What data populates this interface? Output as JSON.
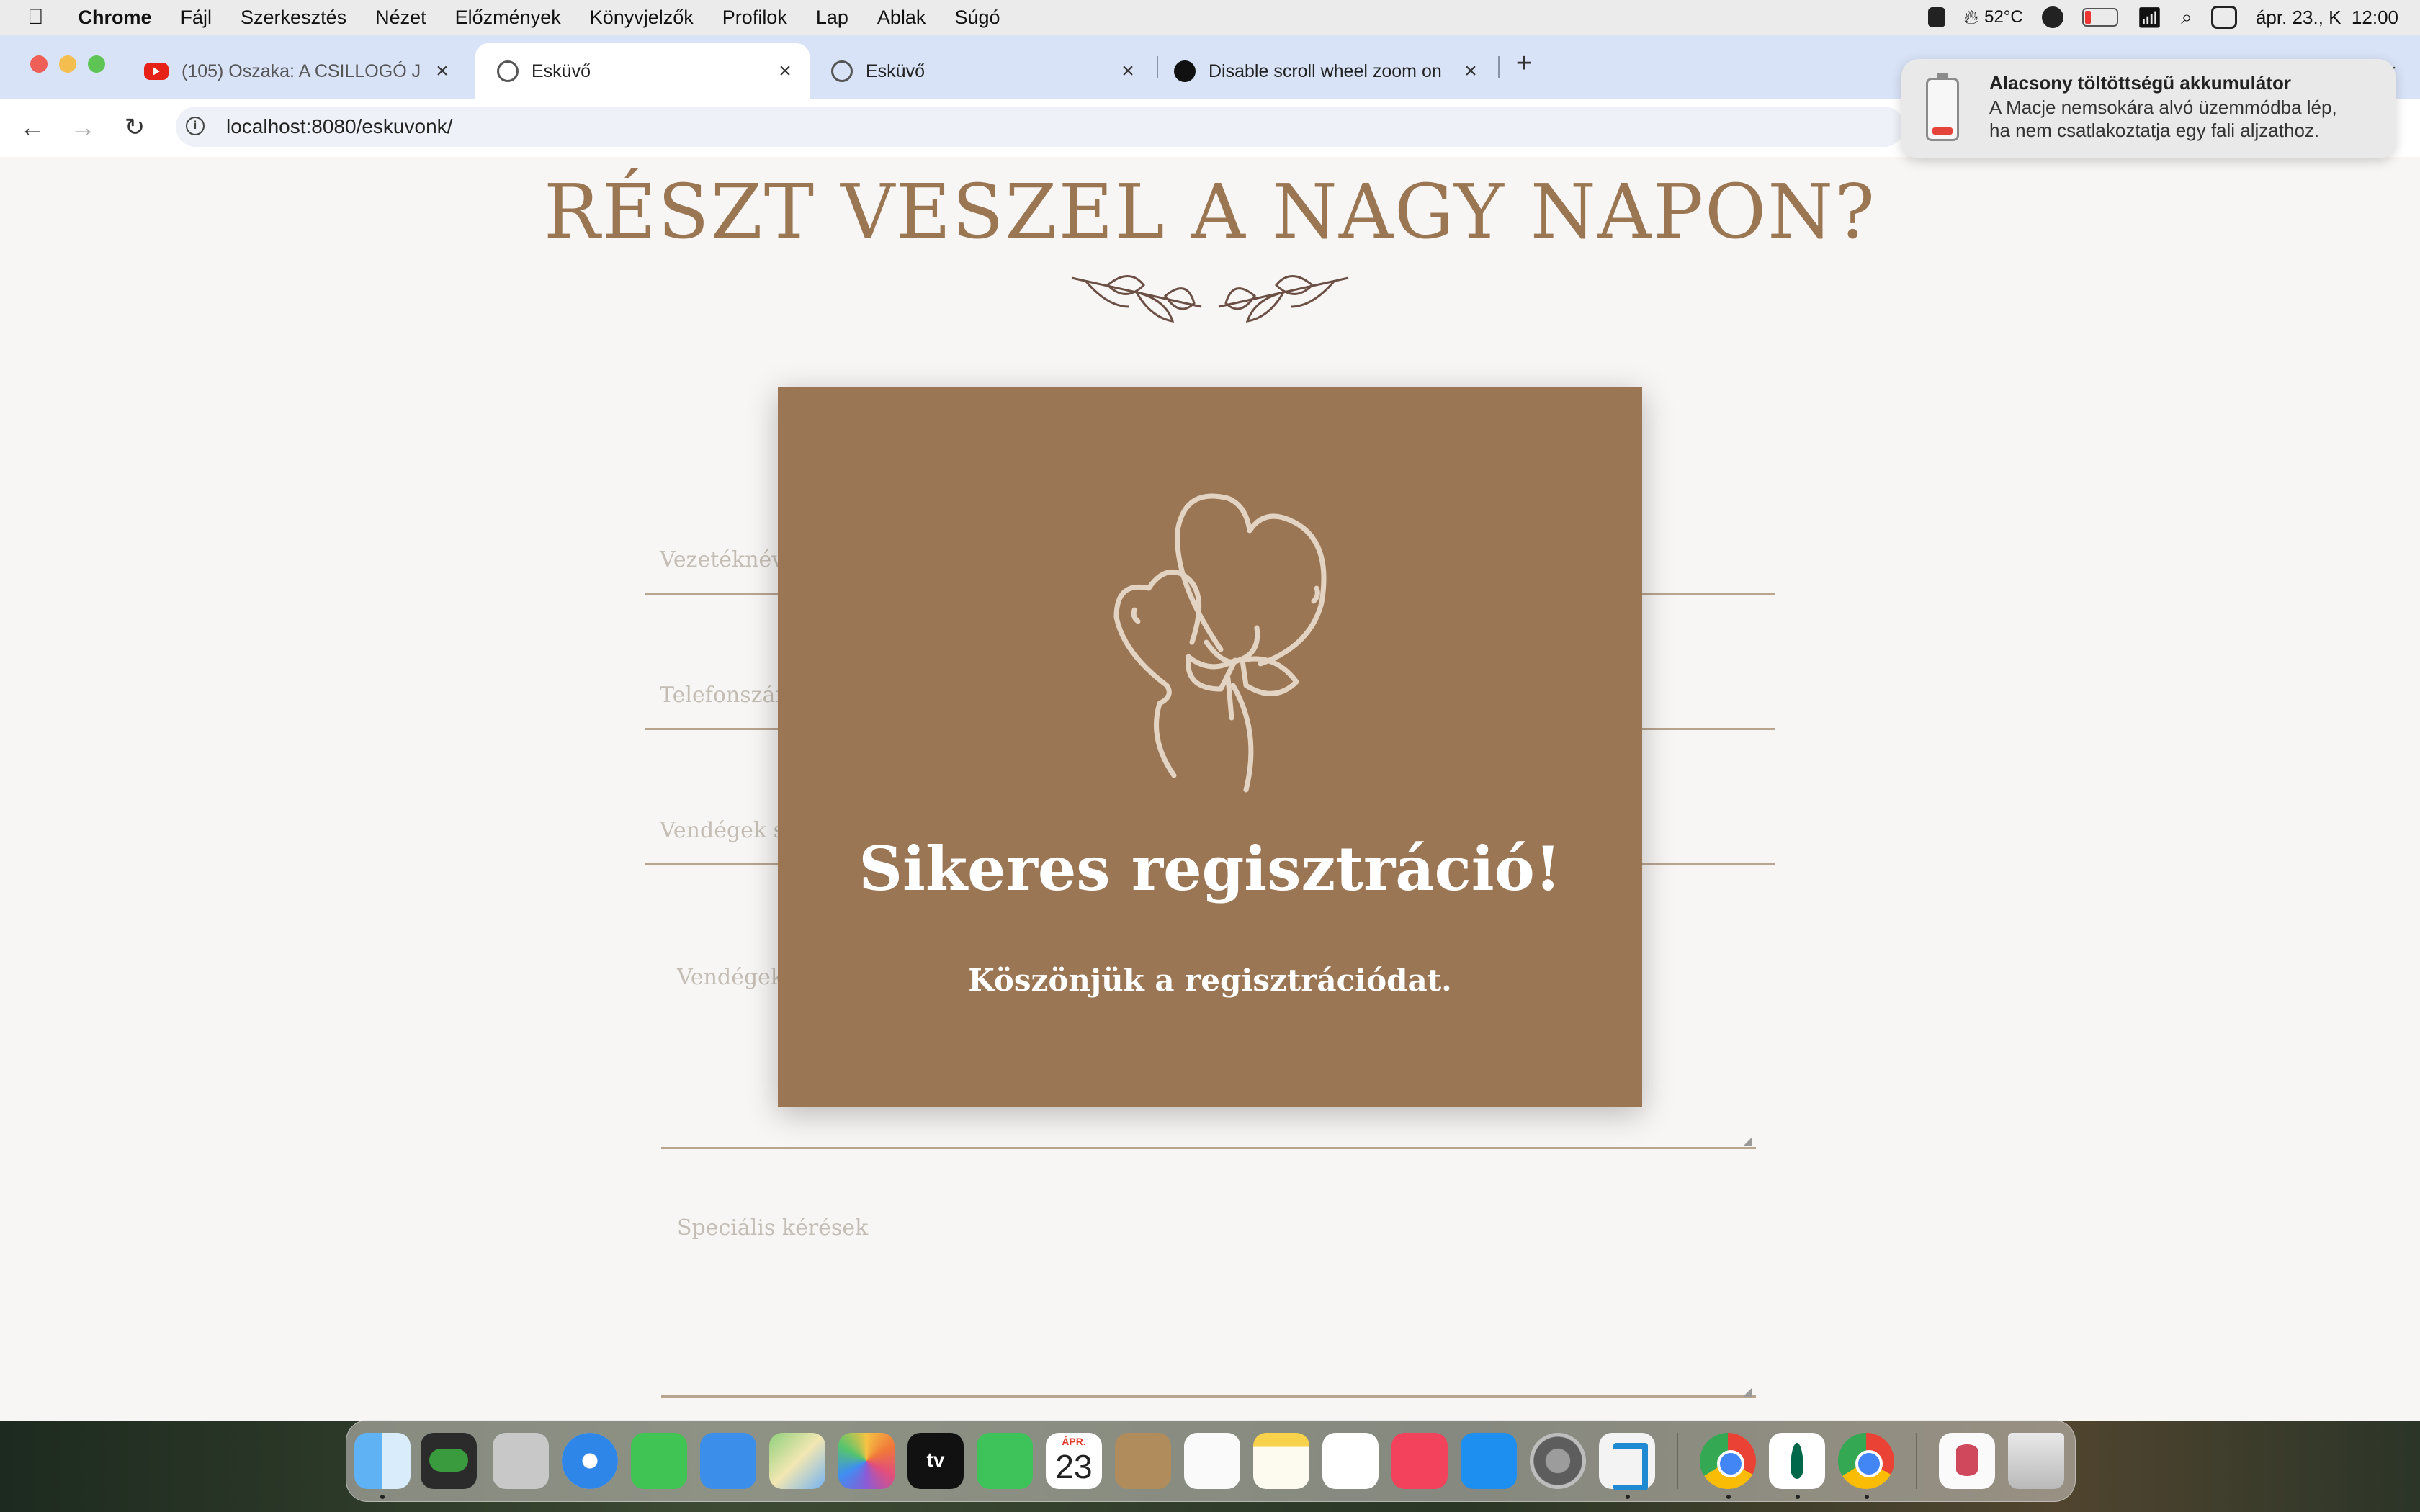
{
  "menubar": {
    "app": "Chrome",
    "items": [
      "Fájl",
      "Szerkesztés",
      "Nézet",
      "Előzmények",
      "Könyvjelzők",
      "Profilok",
      "Lap",
      "Ablak",
      "Súgó"
    ],
    "temperature": "52°C",
    "clock": "ápr. 23., K  12:00"
  },
  "tabs": [
    {
      "title": "(105) Oszaka: A CSILLOGÓ J",
      "icon": "youtube-icon"
    },
    {
      "title": "Esküvő",
      "icon": "globe-icon"
    },
    {
      "title": "Esküvő",
      "icon": "globe-icon"
    },
    {
      "title": "Disable scroll wheel zoom on",
      "icon": "site-icon"
    }
  ],
  "address": {
    "url": "localhost:8080/eskuvonk/"
  },
  "page": {
    "heading": "RÉSZT VESZEL A NAGY NAPON?",
    "fields": {
      "lastname": "Vezetéknév",
      "phone": "Telefonszám",
      "guests_count": "Vendégek s",
      "guests_names": "Vendégek",
      "special": "Speciális kérések"
    }
  },
  "modal": {
    "title": "Sikeres regisztráció!",
    "text": "Köszönjük a regisztrációdat.",
    "icon": "balloons-icon"
  },
  "notification": {
    "title": "Alacsony töltöttségű akkumulátor",
    "body_line1": "A Macje nemsokára alvó üzemmódba lép,",
    "body_line2": "ha nem csatlakoztatja egy fali aljzathoz."
  },
  "dock": {
    "calendar_month": "ÁPR.",
    "calendar_day": "23",
    "tv_label": "tv"
  }
}
